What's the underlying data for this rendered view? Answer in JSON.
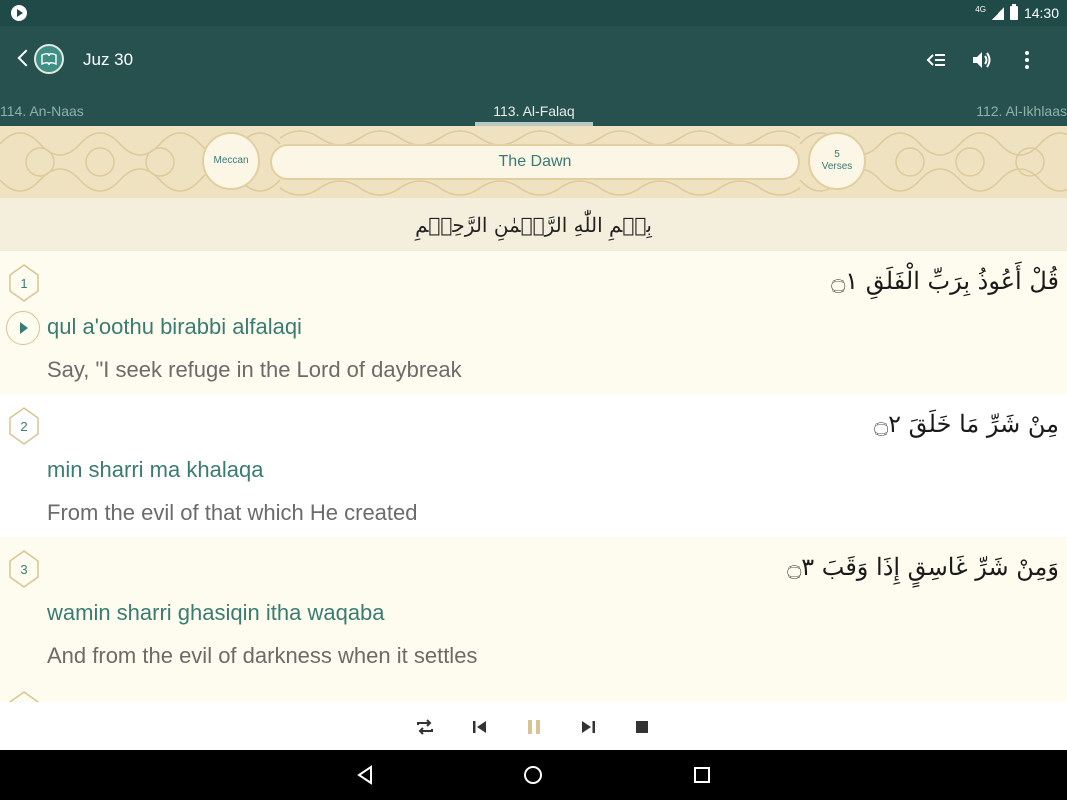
{
  "status_bar": {
    "time": "14:30",
    "network": "4G"
  },
  "app_bar": {
    "title": "Juz 30",
    "tabs": {
      "prev": "114. An-Naas",
      "current": "113. Al-Falaq",
      "next": "112. Al-Ikhlaas"
    }
  },
  "surah_header": {
    "revelation": "Meccan",
    "name": "The Dawn",
    "verse_count": "5",
    "verses_label": "Verses"
  },
  "bismillah": "بِسۡمِ اللّٰهِ الرَّحۡمٰنِ الرَّحِيۡمِ",
  "verses": [
    {
      "number": "1",
      "arabic": "قُلْ أَعُوذُ بِرَبِّ الْفَلَقِ ۝١",
      "translit": "qul a'oothu birabbi alfalaqi",
      "translation": "Say, \"I seek refuge in the Lord of daybreak"
    },
    {
      "number": "2",
      "arabic": "مِنْ شَرِّ مَا خَلَقَ ۝٢",
      "translit": "min sharri ma khalaqa",
      "translation": "From the evil of that which He created"
    },
    {
      "number": "3",
      "arabic": "وَمِنْ شَرِّ غَاسِقٍ إِذَا وَقَبَ ۝٣",
      "translit": "wamin sharri ghasiqin itha waqaba",
      "translation": "And from the evil of darkness when it settles"
    }
  ],
  "colors": {
    "primary": "#27514e",
    "accent": "#3a7b73",
    "gold": "#d8c393"
  }
}
